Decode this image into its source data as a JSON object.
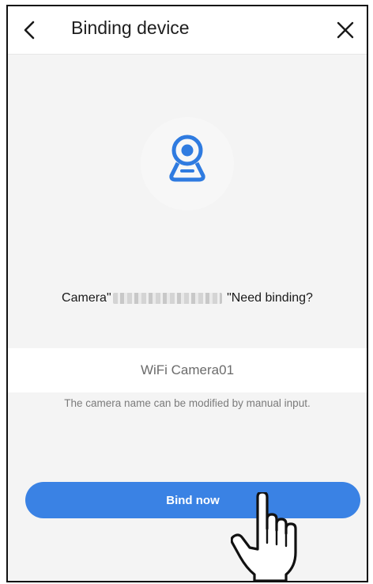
{
  "header": {
    "title": "Binding device",
    "back_icon": "chevron-left-icon",
    "close_icon": "close-icon"
  },
  "main": {
    "camera_icon": "camera-icon",
    "prompt_prefix": "Camera\"",
    "prompt_suffix": " \"Need binding?",
    "camera_name_value": "WiFi Camera01",
    "hint": "The camera name can be modified by manual input.",
    "bind_label": "Bind now",
    "pointer_icon": "hand-pointer-icon"
  },
  "colors": {
    "accent": "#3a82e4",
    "background": "#f4f4f4"
  }
}
